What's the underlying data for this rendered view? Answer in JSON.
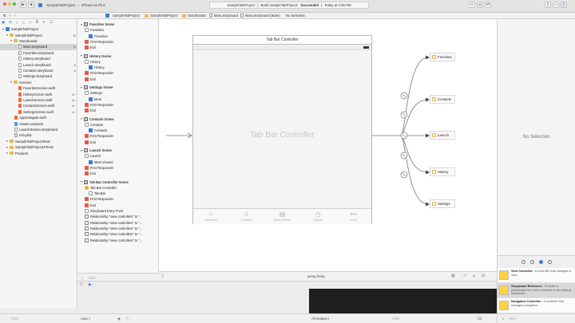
{
  "toolbar": {
    "scheme_project": "SampleTabProject",
    "scheme_device": "iPhone 6s Plus",
    "status_project": "SampleTabProject",
    "status_action": "Build SampleTabProject:",
    "status_result": "Succeeded",
    "status_time": "Today at 2:55 PM",
    "colors": {
      "close": "#fc615d",
      "minimize": "#fdbc40",
      "zoom": "#34c84a"
    }
  },
  "jumpbar": {
    "crumbs": [
      "SampleTabProject",
      "SampleTabProject",
      "Storyboards",
      "Main.storyboard",
      "Main.storyboard (Base)",
      "No Selection"
    ]
  },
  "navigator": {
    "rows": [
      {
        "label": "SampleTabProject",
        "badge": "",
        "indent": 0,
        "icon": "project-icon",
        "disc": "open"
      },
      {
        "label": "SampleTabProject",
        "badge": "M",
        "indent": 1,
        "icon": "folder-icon",
        "disc": "open"
      },
      {
        "label": "Storyboards",
        "badge": "",
        "indent": 2,
        "icon": "folder-icon",
        "disc": "open"
      },
      {
        "label": "Main.storyboard",
        "badge": "M",
        "indent": 3,
        "icon": "storyboard-icon",
        "disc": "",
        "selected": true
      },
      {
        "label": "Favorites.storyboard",
        "badge": "",
        "indent": 3,
        "icon": "storyboard-icon",
        "disc": ""
      },
      {
        "label": "History.storyboard",
        "badge": "",
        "indent": 3,
        "icon": "storyboard-icon",
        "disc": ""
      },
      {
        "label": "Launch.storyboard",
        "badge": "A",
        "indent": 3,
        "icon": "storyboard-icon",
        "disc": ""
      },
      {
        "label": "Contacts.storyboard",
        "badge": "A",
        "indent": 3,
        "icon": "storyboard-icon",
        "disc": ""
      },
      {
        "label": "Settings.storyboard",
        "badge": "",
        "indent": 3,
        "icon": "storyboard-icon",
        "disc": ""
      },
      {
        "label": "Screens",
        "badge": "",
        "indent": 2,
        "icon": "folder-icon",
        "disc": "open"
      },
      {
        "label": "FavoritesScreen.swift",
        "badge": "",
        "indent": 3,
        "icon": "swift-icon",
        "disc": ""
      },
      {
        "label": "HistoryScreen.swift",
        "badge": "A+",
        "indent": 3,
        "icon": "swift-icon",
        "disc": ""
      },
      {
        "label": "LaunchScreen.swift",
        "badge": "A+",
        "indent": 3,
        "icon": "swift-icon",
        "disc": ""
      },
      {
        "label": "ContactsScreen.swift",
        "badge": "A+",
        "indent": 3,
        "icon": "swift-icon",
        "disc": ""
      },
      {
        "label": "SettingsScreen.swift",
        "badge": "A+",
        "indent": 3,
        "icon": "swift-icon",
        "disc": ""
      },
      {
        "label": "AppDelegate.swift",
        "badge": "",
        "indent": 2,
        "icon": "swift-icon",
        "disc": ""
      },
      {
        "label": "Assets.xcassets",
        "badge": "",
        "indent": 2,
        "icon": "assets-icon",
        "disc": ""
      },
      {
        "label": "LaunchScreen.storyboard",
        "badge": "",
        "indent": 2,
        "icon": "storyboard-icon",
        "disc": ""
      },
      {
        "label": "Info.plist",
        "badge": "",
        "indent": 2,
        "icon": "plist-icon",
        "disc": ""
      },
      {
        "label": "SampleTabProjectTests",
        "badge": "",
        "indent": 1,
        "icon": "folder-icon",
        "disc": "closed"
      },
      {
        "label": "SampleTabProjectUITests",
        "badge": "",
        "indent": 1,
        "icon": "folder-icon",
        "disc": "closed"
      },
      {
        "label": "Products",
        "badge": "",
        "indent": 1,
        "icon": "folder-icon",
        "disc": "closed"
      }
    ],
    "filter_placeholder": "Filter"
  },
  "outline": {
    "rows": [
      {
        "label": "Favorites Scene",
        "kind": "scene",
        "indent": 0
      },
      {
        "label": "Favorites",
        "kind": "vc",
        "indent": 1
      },
      {
        "label": "Favorites",
        "kind": "tabitem",
        "indent": 2
      },
      {
        "label": "First Responder",
        "kind": "fr",
        "indent": 1
      },
      {
        "label": "Exit",
        "kind": "exit",
        "indent": 1
      },
      {
        "label": "History Scene",
        "kind": "scene",
        "indent": 0
      },
      {
        "label": "History",
        "kind": "vc",
        "indent": 1
      },
      {
        "label": "History",
        "kind": "tabitem",
        "indent": 2
      },
      {
        "label": "First Responder",
        "kind": "fr",
        "indent": 1
      },
      {
        "label": "Exit",
        "kind": "exit",
        "indent": 1
      },
      {
        "label": "Settings Scene",
        "kind": "scene",
        "indent": 0
      },
      {
        "label": "Settings",
        "kind": "vc",
        "indent": 1
      },
      {
        "label": "More",
        "kind": "tabitem",
        "indent": 2
      },
      {
        "label": "First Responder",
        "kind": "fr",
        "indent": 1
      },
      {
        "label": "Exit",
        "kind": "exit",
        "indent": 1
      },
      {
        "label": "Contacts Scene",
        "kind": "scene",
        "indent": 0
      },
      {
        "label": "Contacts",
        "kind": "vc",
        "indent": 1
      },
      {
        "label": "Contacts",
        "kind": "tabitem",
        "indent": 2
      },
      {
        "label": "First Responder",
        "kind": "fr",
        "indent": 1
      },
      {
        "label": "Exit",
        "kind": "exit",
        "indent": 1
      },
      {
        "label": "Launch Scene",
        "kind": "scene",
        "indent": 0
      },
      {
        "label": "Launch",
        "kind": "vc",
        "indent": 1
      },
      {
        "label": "Most Viewed",
        "kind": "tabitem",
        "indent": 2
      },
      {
        "label": "First Responder",
        "kind": "fr",
        "indent": 1
      },
      {
        "label": "Exit",
        "kind": "exit",
        "indent": 1
      },
      {
        "label": "Tab Bar Controller Scene",
        "kind": "scene",
        "indent": 0
      },
      {
        "label": "Tab Bar Controller",
        "kind": "tbc",
        "indent": 1
      },
      {
        "label": "Tab Bar",
        "kind": "vc",
        "indent": 2
      },
      {
        "label": "First Responder",
        "kind": "fr",
        "indent": 1
      },
      {
        "label": "Exit",
        "kind": "exit",
        "indent": 1
      },
      {
        "label": "Storyboard Entry Point",
        "kind": "vc",
        "indent": 1
      },
      {
        "label": "Relationship \"view controllers\" to \"...",
        "kind": "rel",
        "indent": 1
      },
      {
        "label": "Relationship \"view controllers\" to \"...",
        "kind": "rel",
        "indent": 1
      },
      {
        "label": "Relationship \"view controllers\" to \"...",
        "kind": "rel",
        "indent": 1
      },
      {
        "label": "Relationship \"view controllers\" to \"...",
        "kind": "rel",
        "indent": 1
      },
      {
        "label": "Relationship \"view controllers\" to \"...",
        "kind": "rel",
        "indent": 1
      }
    ],
    "filter_placeholder": "Filter"
  },
  "canvas": {
    "scene_title": "Tab Bar Controller",
    "body_label": "Tab Bar Controller",
    "tabs": [
      {
        "label": "Favorites",
        "icon": "star-icon",
        "glyph": "☆"
      },
      {
        "label": "Contacts",
        "icon": "contacts-icon",
        "glyph": "☺"
      },
      {
        "label": "Most Viewed",
        "icon": "most-viewed-icon",
        "glyph": "▤"
      },
      {
        "label": "History",
        "icon": "history-icon",
        "glyph": "◷"
      },
      {
        "label": "More",
        "icon": "more-icon",
        "glyph": "•••"
      }
    ],
    "children": [
      "Favorites",
      "Contacts",
      "Launch",
      "History",
      "Settings"
    ],
    "size_class": "wAny hAny"
  },
  "debug": {
    "auto_label": "Auto ◊",
    "output_label": "All Output ◊",
    "filter_placeholder": "Filter"
  },
  "inspector": {
    "empty_text": "No Selection"
  },
  "library": {
    "items": [
      {
        "title": "View Controller",
        "desc": " - A controller that manages a view."
      },
      {
        "title": "Storyboard Reference",
        "desc": " - Provides a placeholder for a view controller in an external storyboard."
      },
      {
        "title": "Navigation Controller",
        "desc": " - A controller that manages navigation."
      }
    ],
    "filter_placeholder": "Filter"
  }
}
